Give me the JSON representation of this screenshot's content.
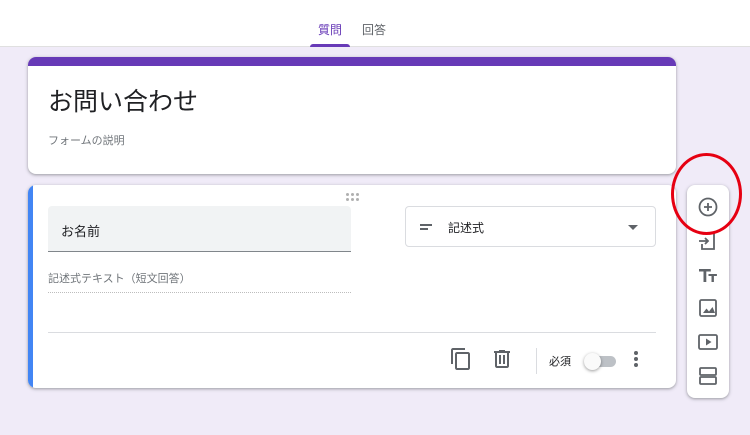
{
  "tabs": [
    {
      "label": "質問",
      "active": true
    },
    {
      "label": "回答",
      "active": false
    }
  ],
  "form": {
    "title": "お問い合わせ",
    "description_placeholder": "フォームの説明"
  },
  "question": {
    "title": "お名前",
    "type_label": "記述式",
    "answer_placeholder": "記述式テキスト（短文回答）",
    "required_label": "必須",
    "required": false
  },
  "toolbar_icons": [
    "add-circle-icon",
    "import-icon",
    "title-text-icon",
    "image-icon",
    "video-icon",
    "section-icon"
  ],
  "colors": {
    "accent": "#673ab7",
    "background": "#f0ebf8",
    "active_question_bar": "#4285f4",
    "annotation": "#e60012"
  }
}
